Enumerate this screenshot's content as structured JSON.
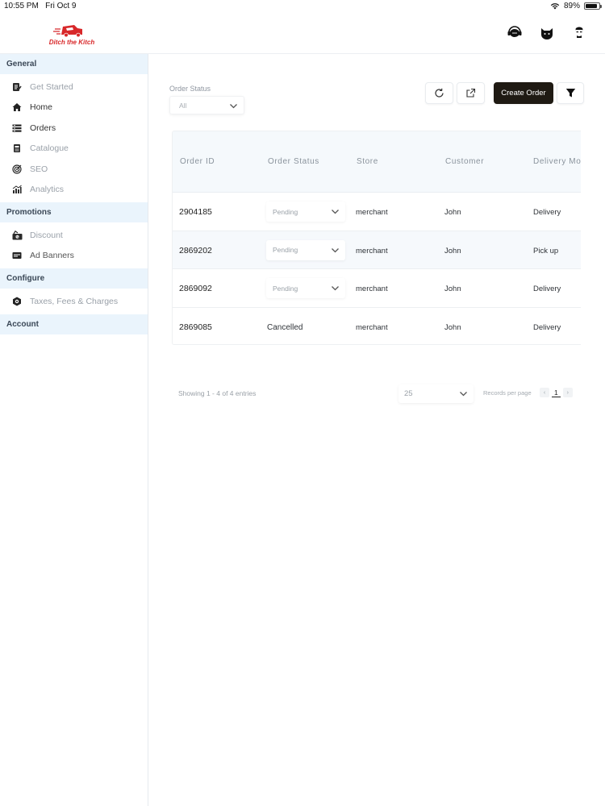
{
  "status_bar": {
    "time": "10:55 PM",
    "date": "Fri Oct 9",
    "battery": "89%",
    "battery_level": 0.89
  },
  "header": {
    "logo_text": "Ditch the Kitch",
    "icons": [
      "support-chat-icon",
      "cat-avatar-icon",
      "profile-icon"
    ]
  },
  "sidebar": {
    "general": {
      "title": "General",
      "items": [
        {
          "label": "Get Started",
          "icon": "checklist-icon",
          "active": false
        },
        {
          "label": "Home",
          "icon": "home-icon",
          "active": true
        },
        {
          "label": "Orders",
          "icon": "orders-icon",
          "active": true
        },
        {
          "label": "Catalogue",
          "icon": "catalogue-icon",
          "active": false
        },
        {
          "label": "SEO",
          "icon": "target-icon",
          "active": false
        },
        {
          "label": "Analytics",
          "icon": "analytics-icon",
          "active": false
        }
      ]
    },
    "promotions": {
      "title": "Promotions",
      "items": [
        {
          "label": "Discount",
          "icon": "discount-icon",
          "active": false
        },
        {
          "label": "Ad Banners",
          "icon": "banner-icon",
          "active": true
        }
      ]
    },
    "configure": {
      "title": "Configure",
      "items": [
        {
          "label": "Taxes, Fees & Charges",
          "icon": "hexagon-settings-icon",
          "active": false
        }
      ]
    },
    "account": {
      "title": "Account"
    }
  },
  "filter": {
    "label": "Order Status",
    "value": "All"
  },
  "toolbar": {
    "create_label": "Create Order"
  },
  "table": {
    "headers": [
      "Order ID",
      "Order Status",
      "Store",
      "Customer",
      "Delivery Mo"
    ],
    "rows": [
      {
        "id": "2904185",
        "status": "Pending",
        "status_editable": true,
        "store": "merchant",
        "customer": "John",
        "delivery": "Delivery"
      },
      {
        "id": "2869202",
        "status": "Pending",
        "status_editable": true,
        "store": "merchant",
        "customer": "John",
        "delivery": "Pick up"
      },
      {
        "id": "2869092",
        "status": "Pending",
        "status_editable": true,
        "store": "merchant",
        "customer": "John",
        "delivery": "Delivery"
      },
      {
        "id": "2869085",
        "status": "Cancelled",
        "status_editable": false,
        "store": "merchant",
        "customer": "John",
        "delivery": "Delivery"
      }
    ]
  },
  "pagination": {
    "showing_text": "Showing 1 - 4 of 4 entries",
    "per_page_value": "25",
    "records_label": "Records per page",
    "current_page": "1",
    "prev": "‹",
    "next": "›"
  }
}
